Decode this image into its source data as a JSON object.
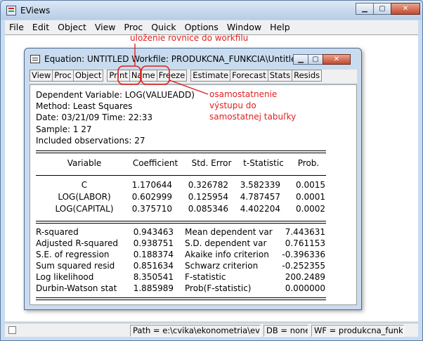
{
  "app": {
    "title": "EViews",
    "menu": [
      "File",
      "Edit",
      "Object",
      "View",
      "Proc",
      "Quick",
      "Options",
      "Window",
      "Help"
    ]
  },
  "equation_window": {
    "title": "Equation: UNTITLED   Workfile: PRODUKCNA_FUNKCIA\\Untitled",
    "toolbar": [
      "View",
      "Proc",
      "Object",
      "Print",
      "Name",
      "Freeze",
      "Estimate",
      "Forecast",
      "Stats",
      "Resids"
    ],
    "header": {
      "dependent": "Dependent Variable: LOG(VALUEADD)",
      "method": "Method: Least Squares",
      "date": "Date: 03/21/09   Time: 22:33",
      "sample": "Sample: 1 27",
      "obs": "Included observations: 27"
    },
    "coef_columns": [
      "Variable",
      "Coefficient",
      "Std. Error",
      "t-Statistic",
      "Prob."
    ],
    "coef_rows": [
      [
        "C",
        "1.170644",
        "0.326782",
        "3.582339",
        "0.0015"
      ],
      [
        "LOG(LABOR)",
        "0.602999",
        "0.125954",
        "4.787457",
        "0.0001"
      ],
      [
        "LOG(CAPITAL)",
        "0.375710",
        "0.085346",
        "4.402204",
        "0.0002"
      ]
    ],
    "stats_rows": [
      [
        "R-squared",
        "0.943463",
        "Mean dependent var",
        "7.443631"
      ],
      [
        "Adjusted R-squared",
        "0.938751",
        "S.D. dependent var",
        "0.761153"
      ],
      [
        "S.E. of regression",
        "0.188374",
        "Akaike info criterion",
        "-0.396336"
      ],
      [
        "Sum squared resid",
        "0.851634",
        "Schwarz criterion",
        "-0.252355"
      ],
      [
        "Log likelihood",
        "8.350541",
        "F-statistic",
        "200.2489"
      ],
      [
        "Durbin-Watson stat",
        "1.885989",
        "Prob(F-statistic)",
        "0.000000"
      ]
    ]
  },
  "annotations": {
    "name_note": "uloženie rovnice do workfilu",
    "freeze_note_1": "osamostatnenie",
    "freeze_note_2": "výstupu do",
    "freeze_note_3": "samostatnej tabuľky"
  },
  "statusbar": {
    "path": "Path = e:\\cvika\\ekonometria\\eview",
    "db": "DB = none",
    "wf": "WF = produkcna_funkcia"
  },
  "colors": {
    "annotation": "#e02020",
    "titlebar": "#c9dcef",
    "close_button": "#c24a2f"
  }
}
